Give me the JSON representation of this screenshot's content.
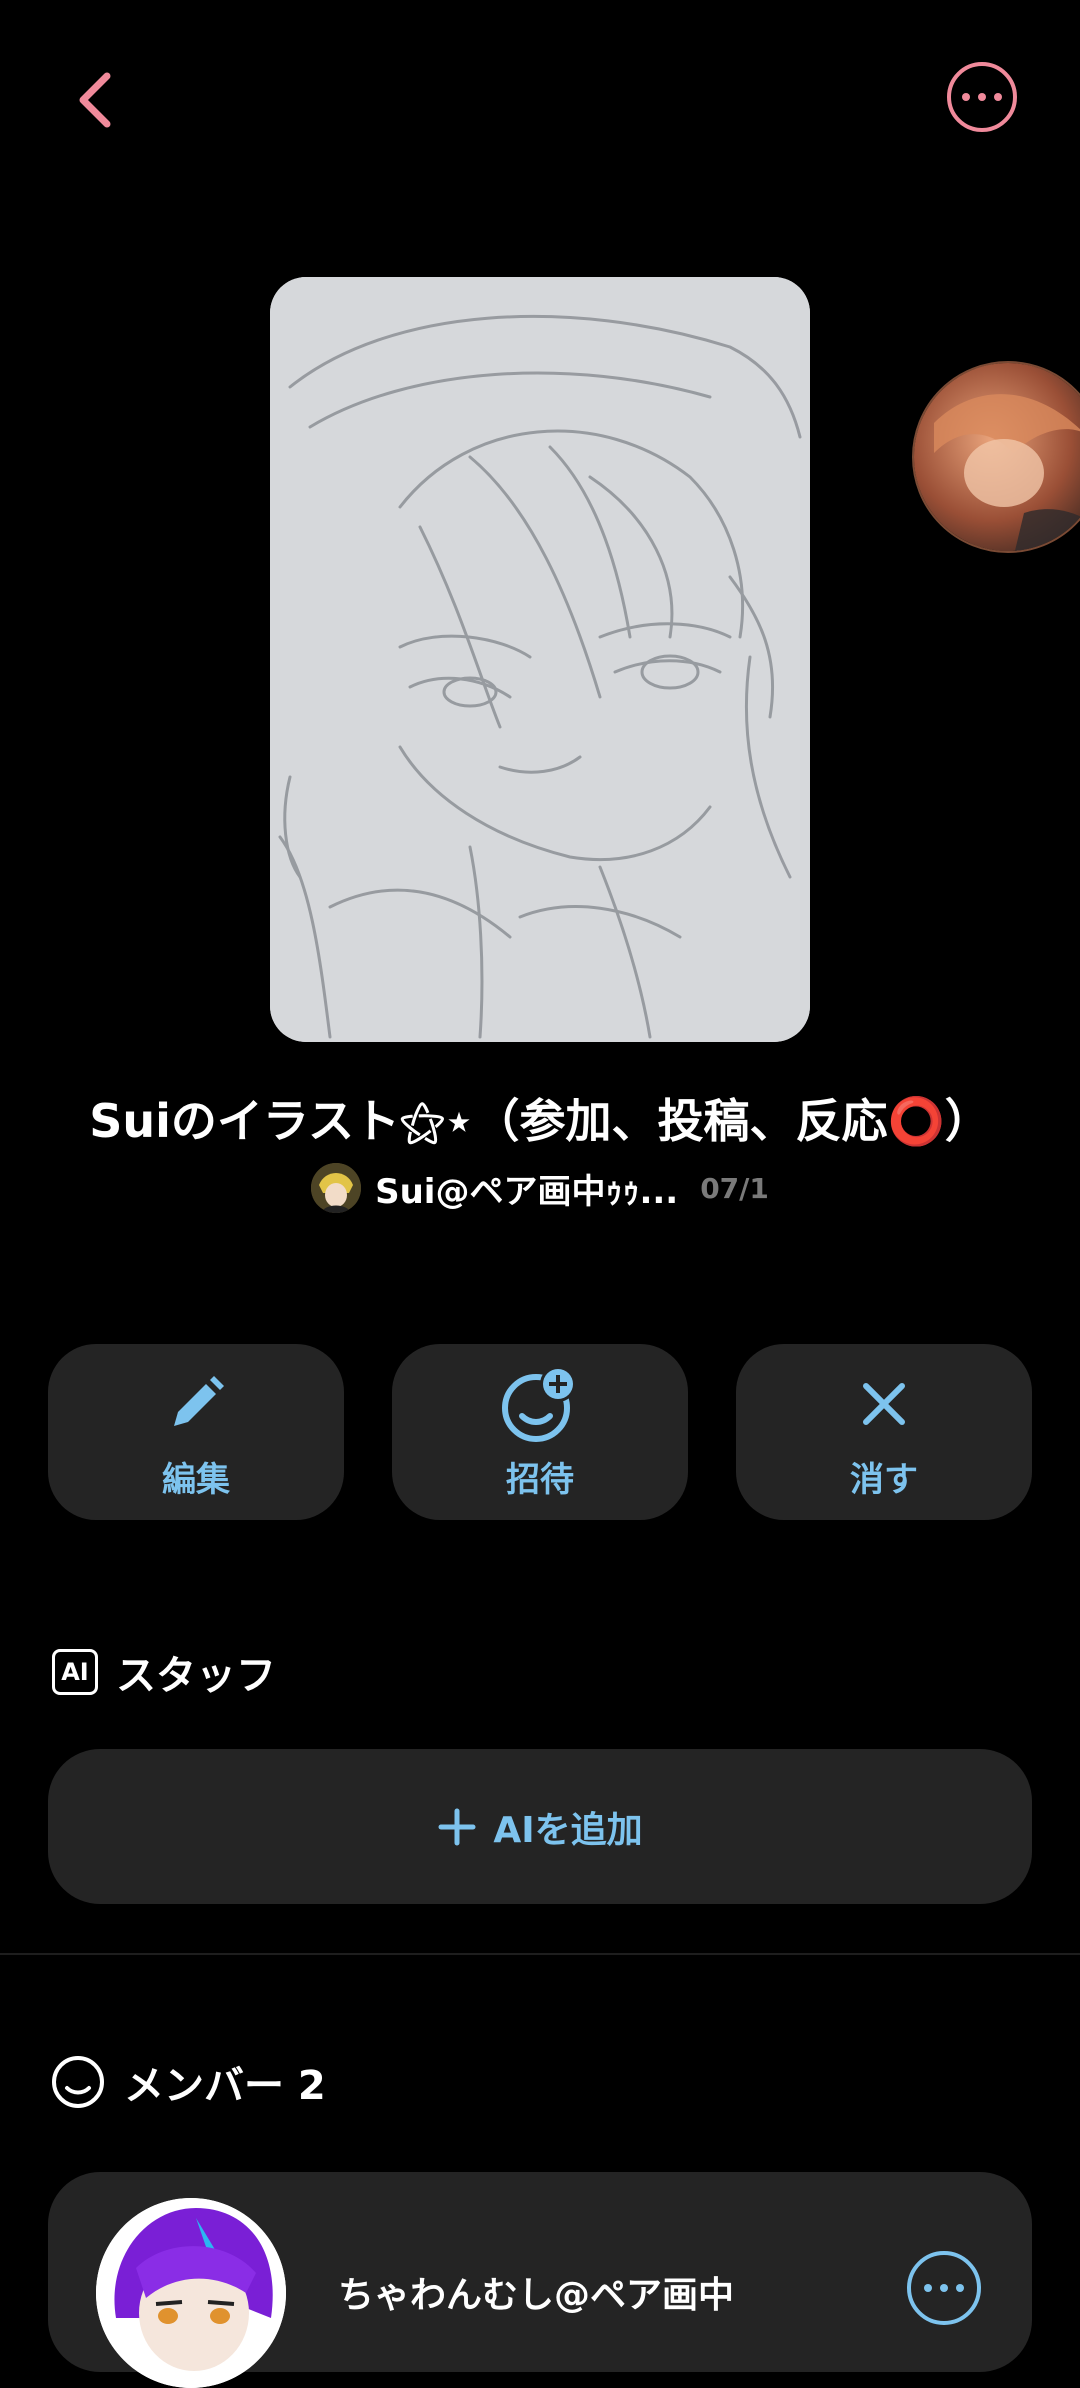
{
  "room": {
    "title": "Suiのイラスト⚝⋆（参加、投稿、反応⭕）",
    "owner_name": "Sui@ペア画中ｩｩ...",
    "date": "07/1"
  },
  "actions": [
    {
      "label": "編集",
      "icon": "pencil-icon"
    },
    {
      "label": "招待",
      "icon": "invite-smiley-plus-icon"
    },
    {
      "label": "消す",
      "icon": "close-x-icon"
    }
  ],
  "staff": {
    "badge": "AI",
    "title": "スタッフ",
    "add_label": "AIを追加"
  },
  "members": {
    "title": "メンバー 2",
    "items": [
      {
        "name": "ちゃわんむし@ペア画中"
      }
    ]
  },
  "colors": {
    "accent_pink": "#f08a9b",
    "accent_blue": "#7dc3ee",
    "card_bg": "#242424",
    "page_bg": "#000000"
  }
}
